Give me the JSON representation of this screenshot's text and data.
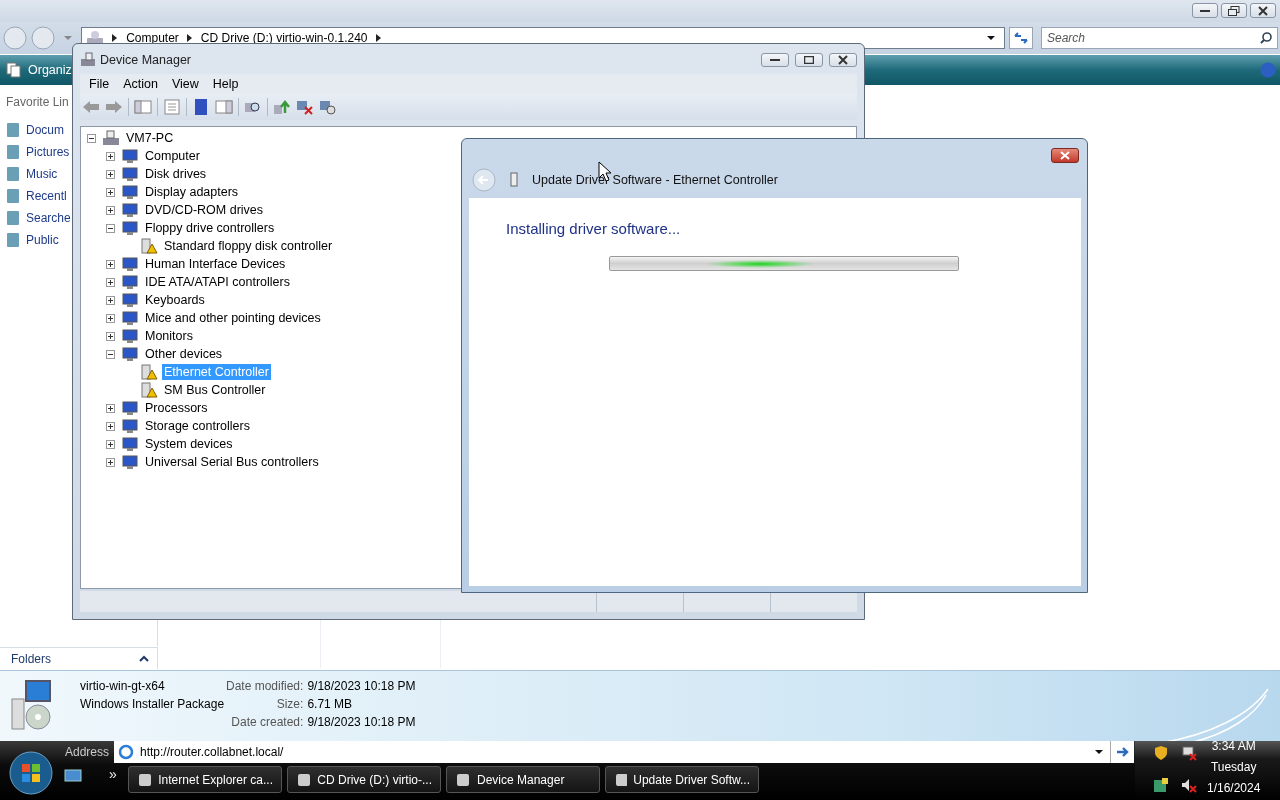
{
  "explorer": {
    "breadcrumbs": [
      "Computer",
      "CD Drive (D:) virtio-win-0.1.240"
    ],
    "search": {
      "placeholder": "Search"
    },
    "organize": "Organiz",
    "nav": {
      "heading": "Favorite Lin",
      "links": [
        "Docum",
        "Pictures",
        "Music",
        "Recentl",
        "Searche",
        "Public"
      ]
    },
    "folders_label": "Folders"
  },
  "details": {
    "file_name": "virtio-win-gt-x64",
    "file_type": "Windows Installer Package",
    "fields": [
      {
        "label": "Date modified:",
        "value": "9/18/2023 10:18 PM"
      },
      {
        "label": "Size:",
        "value": "6.71 MB"
      },
      {
        "label": "Date created:",
        "value": "9/18/2023 10:18 PM"
      }
    ]
  },
  "device_manager": {
    "title": "Device Manager",
    "menu": [
      "File",
      "Action",
      "View",
      "Help"
    ],
    "tree": {
      "label": "VM7-PC",
      "expanded": true,
      "selected": false,
      "children": [
        {
          "label": "Computer",
          "expanded": false,
          "selected": false
        },
        {
          "label": "Disk drives",
          "expanded": false,
          "selected": false
        },
        {
          "label": "Display adapters",
          "expanded": false,
          "selected": false
        },
        {
          "label": "DVD/CD-ROM drives",
          "expanded": false,
          "selected": false
        },
        {
          "label": "Floppy drive controllers",
          "expanded": true,
          "selected": false,
          "children": [
            {
              "label": "Standard floppy disk controller",
              "selected": false,
              "warning": true
            }
          ]
        },
        {
          "label": "Human Interface Devices",
          "expanded": false,
          "selected": false
        },
        {
          "label": "IDE ATA/ATAPI controllers",
          "expanded": false,
          "selected": false
        },
        {
          "label": "Keyboards",
          "expanded": false,
          "selected": false
        },
        {
          "label": "Mice and other pointing devices",
          "expanded": false,
          "selected": false
        },
        {
          "label": "Monitors",
          "expanded": false,
          "selected": false
        },
        {
          "label": "Other devices",
          "expanded": true,
          "selected": false,
          "children": [
            {
              "label": "Ethernet Controller",
              "selected": true,
              "warning": true
            },
            {
              "label": "SM Bus Controller",
              "selected": false,
              "warning": true
            }
          ]
        },
        {
          "label": "Processors",
          "expanded": false,
          "selected": false
        },
        {
          "label": "Storage controllers",
          "expanded": false,
          "selected": false
        },
        {
          "label": "System devices",
          "expanded": false,
          "selected": false
        },
        {
          "label": "Universal Serial Bus controllers",
          "expanded": false,
          "selected": false
        }
      ]
    }
  },
  "dialog": {
    "title": "Update Driver Software - Ethernet Controller",
    "heading": "Installing driver software...",
    "progress": {
      "indeterminate": true
    }
  },
  "taskbar": {
    "address_label": "Address",
    "address": "http://router.collabnet.local/",
    "chevron": "»",
    "tasks": [
      {
        "label": "Internet Explorer ca..."
      },
      {
        "label": "CD Drive (D:) virtio-..."
      },
      {
        "label": "Device Manager"
      },
      {
        "label": "Update Driver Softw..."
      }
    ],
    "clock": {
      "time": "3:34 AM",
      "day": "Tuesday",
      "date": "1/16/2024"
    }
  }
}
